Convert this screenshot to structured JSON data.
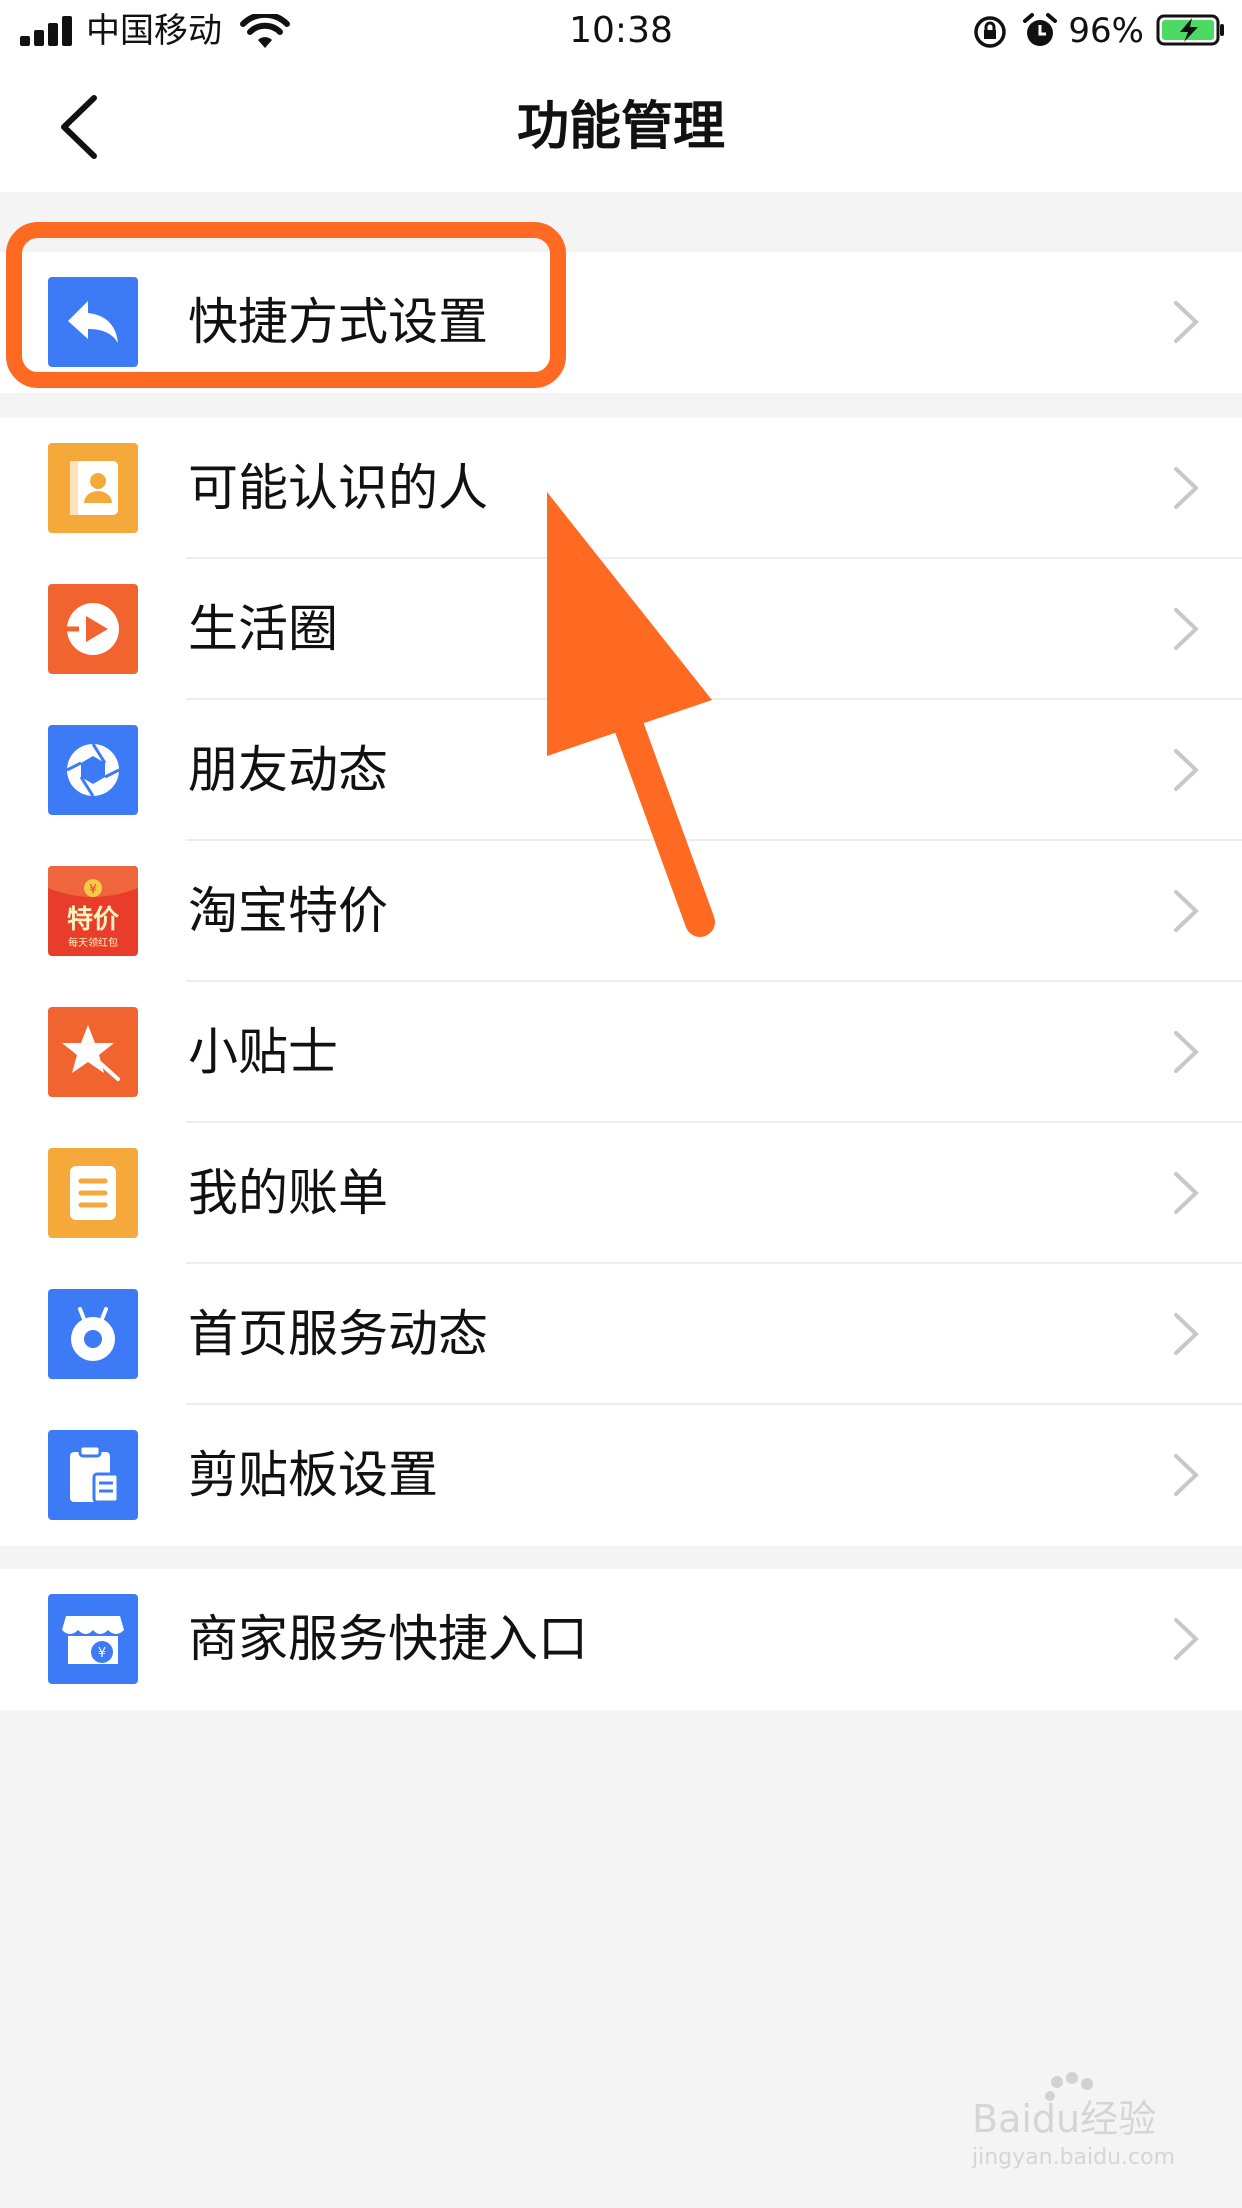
{
  "status_bar": {
    "carrier": "中国移动",
    "time": "10:38",
    "battery_percent": "96%",
    "icons": [
      "signal-icon",
      "wifi-icon",
      "rotation-lock-icon",
      "alarm-icon",
      "battery-charging-icon"
    ]
  },
  "nav": {
    "title": "功能管理",
    "back_icon": "chevron-left-icon"
  },
  "groups": [
    {
      "items": [
        {
          "label": "快捷方式设置",
          "icon": "shortcut-icon",
          "color": "#3d7af5"
        }
      ]
    },
    {
      "items": [
        {
          "label": "可能认识的人",
          "icon": "contacts-icon",
          "color": "#f5a93a"
        },
        {
          "label": "生活圈",
          "icon": "life-circle-icon",
          "color": "#f2642f"
        },
        {
          "label": "朋友动态",
          "icon": "camera-aperture-icon",
          "color": "#3d7af5"
        },
        {
          "label": "淘宝特价",
          "icon": "taobao-special-icon",
          "color": "#e93d2b"
        },
        {
          "label": "小贴士",
          "icon": "tips-star-icon",
          "color": "#f2642f"
        },
        {
          "label": "我的账单",
          "icon": "bill-icon",
          "color": "#f5a93a"
        },
        {
          "label": "首页服务动态",
          "icon": "home-service-icon",
          "color": "#3d7af5"
        },
        {
          "label": "剪贴板设置",
          "icon": "clipboard-icon",
          "color": "#3d7af5"
        }
      ]
    },
    {
      "items": [
        {
          "label": "商家服务快捷入口",
          "icon": "merchant-store-icon",
          "color": "#3d7af5"
        }
      ]
    }
  ],
  "taobao_icon_text": {
    "line1": "特价",
    "line2": "每天领红包",
    "coin": "¥"
  },
  "merchant_icon_text": "¥",
  "annotation": {
    "color": "#ff6a22"
  },
  "watermark": {
    "brand": "Baidu经验",
    "url": "jingyan.baidu.com"
  }
}
